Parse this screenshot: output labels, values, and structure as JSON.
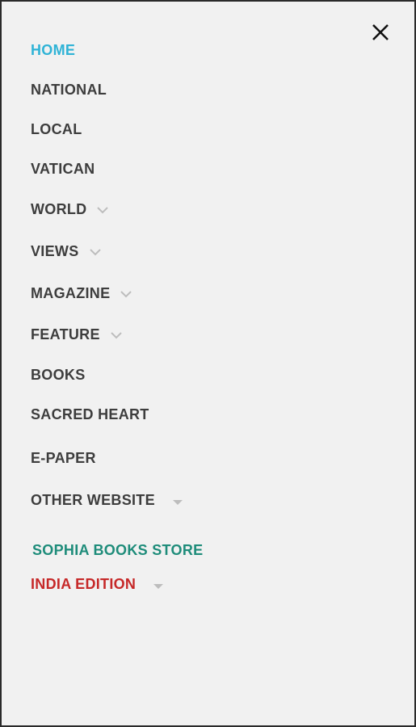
{
  "menu": {
    "colors": {
      "default": "#3d3d3d",
      "active": "#2fb3d6",
      "sophia": "#1e8c7a",
      "india": "#c62828",
      "chevron": "#bdbdbd"
    },
    "close_icon": "close-icon",
    "items": [
      {
        "label": "HOME",
        "active": true
      },
      {
        "label": "NATIONAL"
      },
      {
        "label": "LOCAL"
      },
      {
        "label": "VATICAN"
      },
      {
        "label": "WORLD",
        "expand_icon": "chevron-down-icon"
      },
      {
        "label": "VIEWS",
        "expand_icon": "chevron-down-icon"
      },
      {
        "label": "MAGAZINE",
        "expand_icon": "chevron-down-icon"
      },
      {
        "label": "FEATURE",
        "expand_icon": "chevron-down-icon"
      },
      {
        "label": "BOOKS"
      },
      {
        "label": "SACRED HEART"
      },
      {
        "label": "E-PAPER"
      },
      {
        "label": "OTHER WEBSITE",
        "expand_icon": "caret-down-icon"
      },
      {
        "label": "SOPHIA BOOKS STORE"
      },
      {
        "label": "INDIA EDITION",
        "expand_icon": "caret-down-icon"
      }
    ]
  }
}
